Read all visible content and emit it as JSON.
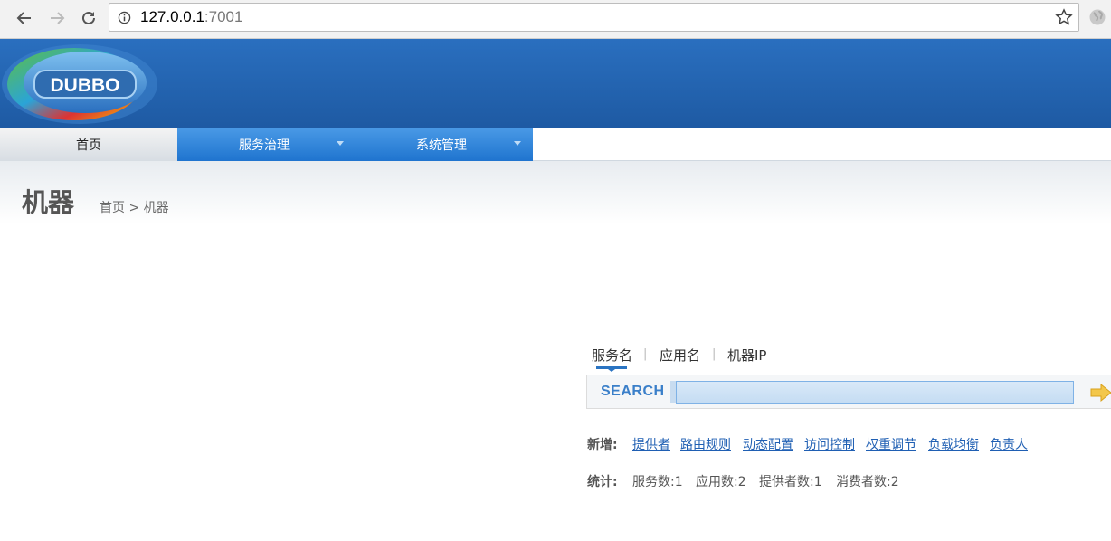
{
  "browser": {
    "url_host": "127.0.0.1",
    "url_port": ":7001"
  },
  "header": {
    "logo_text": "DUBBO"
  },
  "nav": {
    "home": "首页",
    "service_governance": "服务治理",
    "system_management": "系统管理"
  },
  "page": {
    "title": "机器",
    "breadcrumb": "首页 > 机器"
  },
  "search": {
    "tabs": [
      "服务名",
      "应用名",
      "机器IP"
    ],
    "active_tab": "服务名",
    "label": "SEARCH",
    "value": ""
  },
  "add": {
    "label": "新增:",
    "links": [
      "提供者",
      "路由规则",
      "动态配置",
      "访问控制",
      "权重调节",
      "负载均衡",
      "负责人"
    ]
  },
  "stats": {
    "label": "统计:",
    "items": [
      "服务数:1",
      "应用数:2",
      "提供者数:1",
      "消费者数:2"
    ]
  },
  "colors": {
    "header_blue": "#1e5aa3",
    "nav_blue": "#1f74cf",
    "link_blue": "#1f5fb3"
  }
}
